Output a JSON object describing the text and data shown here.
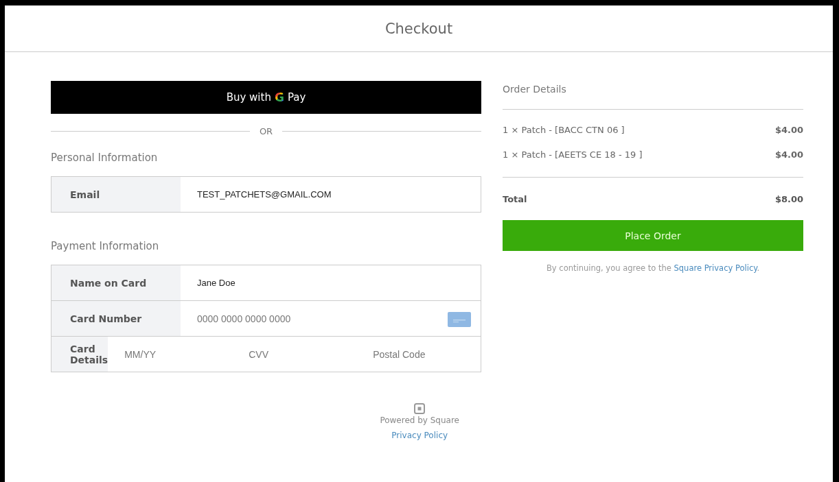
{
  "header": {
    "title": "Checkout"
  },
  "payment": {
    "gpay_button": {
      "prefix": "Buy with",
      "logo_letter": "G",
      "suffix": "Pay"
    },
    "divider_text": "OR",
    "personal": {
      "heading": "Personal Information",
      "fields": [
        {
          "label": "Email",
          "value": "TEST_PATCHETS@GMAIL.COM"
        }
      ]
    },
    "card": {
      "heading": "Payment Information",
      "rows": [
        {
          "kind": "value",
          "label": "Name on Card",
          "value": "Jane Doe"
        },
        {
          "kind": "card",
          "label": "Card Number",
          "placeholder": "0000 0000 0000 0000"
        },
        {
          "kind": "split",
          "label": "Card Details",
          "placeholders": [
            "MM/YY",
            "CVV",
            "Postal Code"
          ]
        }
      ]
    }
  },
  "order": {
    "heading": "Order Details",
    "items": [
      {
        "name": "1 × Patch - [BACC CTN 06 ]",
        "price": "$4.00"
      },
      {
        "name": "1 × Patch - [AEETS CE 18 - 19 ]",
        "price": "$4.00"
      }
    ],
    "total": {
      "label": "Total",
      "amount": "$8.00"
    },
    "place_order": "Place Order",
    "agreement": {
      "text": "By continuing, you agree to the ",
      "link": "Square Privacy Policy",
      "after": "."
    }
  },
  "footer": {
    "powered": "Powered by Square",
    "link": "Privacy Policy"
  }
}
